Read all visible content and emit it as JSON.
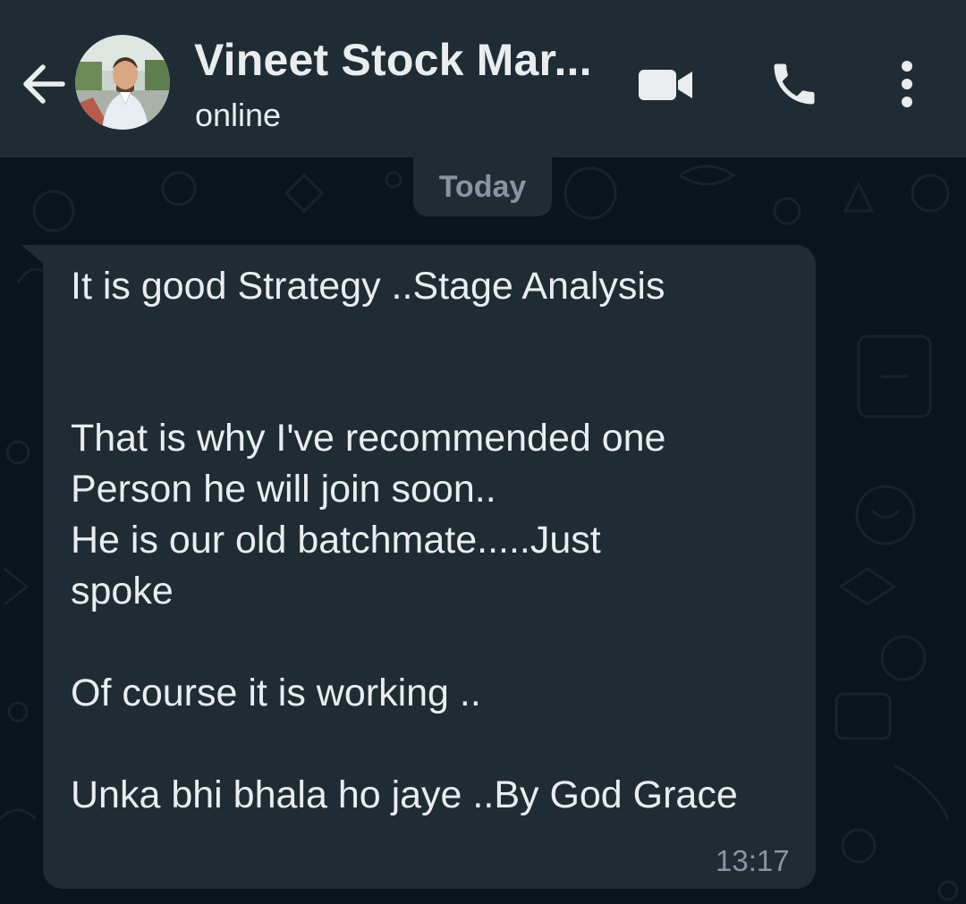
{
  "header": {
    "contact_name": "Vineet Stock Mar...",
    "status": "online",
    "back_icon": "arrow-left-icon",
    "video_icon": "video-camera-icon",
    "call_icon": "phone-icon",
    "menu_icon": "more-vertical-icon"
  },
  "chat": {
    "date_label": "Today",
    "message": {
      "lines": [
        "It is good Strategy ..Stage Analysis",
        "That is why I've recommended one",
        "Person he will join soon..",
        "He is our old batchmate.....Just",
        "spoke",
        "Of course it is working ..",
        "Unka bhi bhala ho jaye ..By God Grace"
      ],
      "time": "13:17"
    }
  },
  "colors": {
    "header_bg": "#1f2c34",
    "chat_bg": "#0b141a",
    "bubble_bg": "#1f2c34",
    "text_primary": "#e9edef",
    "text_secondary": "#8696a0"
  }
}
